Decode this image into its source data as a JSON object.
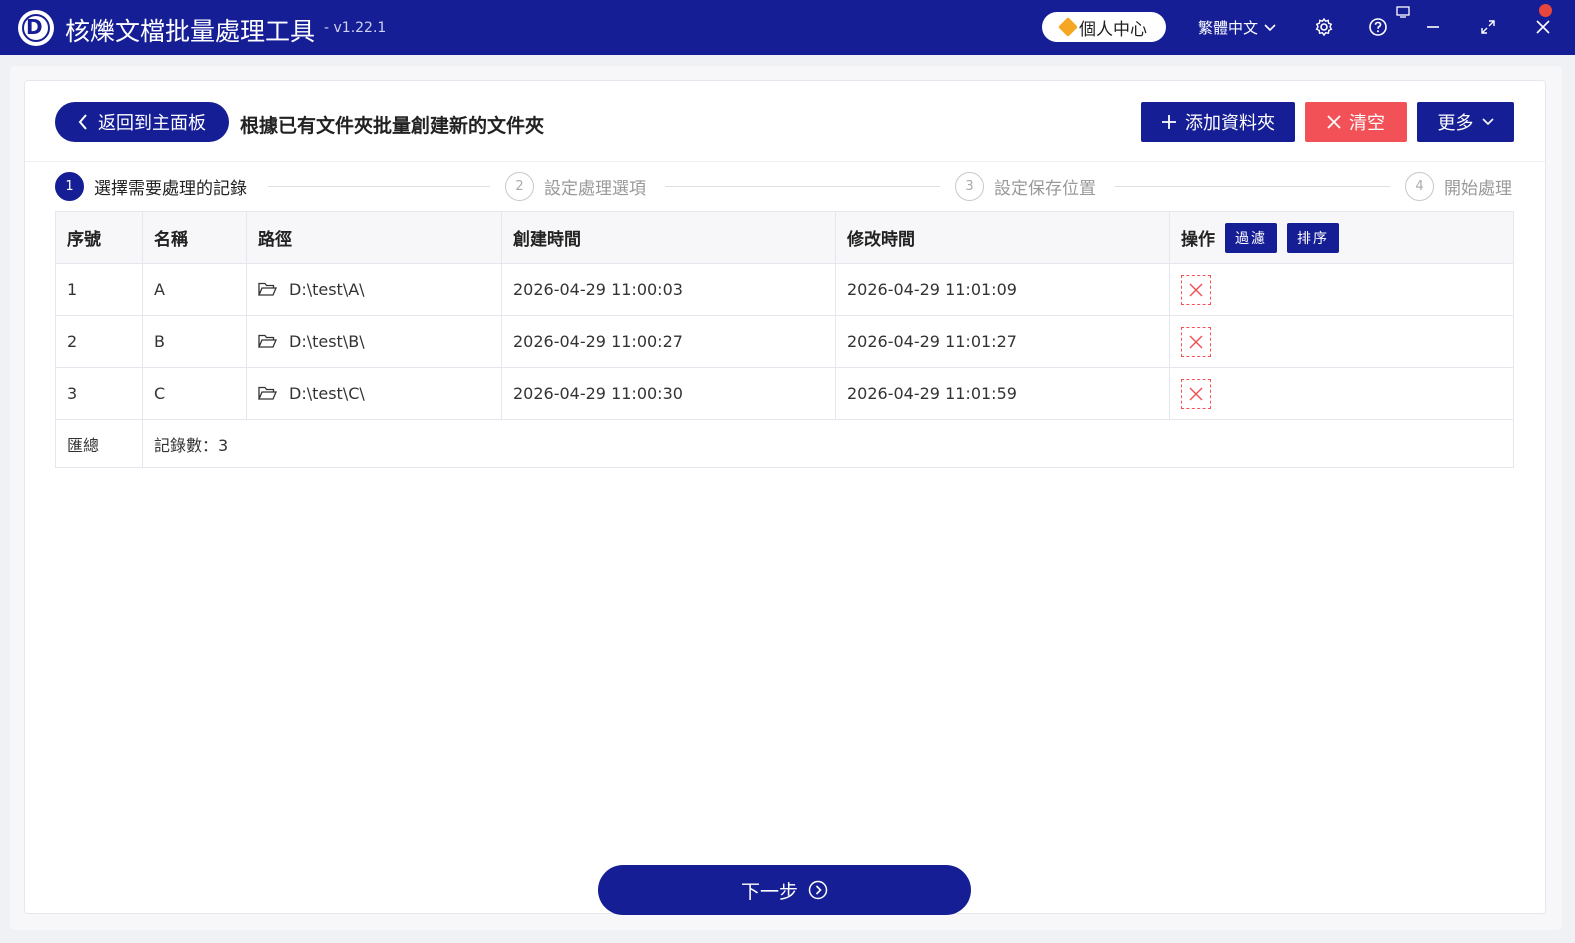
{
  "app": {
    "title": "核爍文檔批量處理工具",
    "version": "- v1.22.1",
    "user_center_label": "個人中心",
    "language": "繁體中文"
  },
  "page": {
    "back_label": "返回到主面板",
    "title": "根據已有文件夾批量創建新的文件夾"
  },
  "toolbar": {
    "add_folder_label": "添加資料夾",
    "clear_label": "清空",
    "more_label": "更多"
  },
  "steps": [
    {
      "num": "1",
      "label": "選擇需要處理的記錄",
      "active": true
    },
    {
      "num": "2",
      "label": "設定處理選項",
      "active": false
    },
    {
      "num": "3",
      "label": "設定保存位置",
      "active": false
    },
    {
      "num": "4",
      "label": "開始處理",
      "active": false
    }
  ],
  "table": {
    "columns": [
      "序號",
      "名稱",
      "路徑",
      "創建時間",
      "修改時間",
      "操作"
    ],
    "filter_label": "過濾",
    "sort_label": "排序",
    "rows": [
      {
        "index": "1",
        "name": "A",
        "path": "D:\\test\\A\\",
        "created": "2026-04-29 11:00:03",
        "modified": "2026-04-29 11:01:09"
      },
      {
        "index": "2",
        "name": "B",
        "path": "D:\\test\\B\\",
        "created": "2026-04-29 11:00:27",
        "modified": "2026-04-29 11:01:27"
      },
      {
        "index": "3",
        "name": "C",
        "path": "D:\\test\\C\\",
        "created": "2026-04-29 11:00:30",
        "modified": "2026-04-29 11:01:59"
      }
    ],
    "summary_label": "匯總",
    "summary_value": "記錄數：3"
  },
  "footer": {
    "next_label": "下一步"
  },
  "colors": {
    "primary": "#161e95",
    "danger": "#f25257",
    "accent": "#f5a623"
  }
}
